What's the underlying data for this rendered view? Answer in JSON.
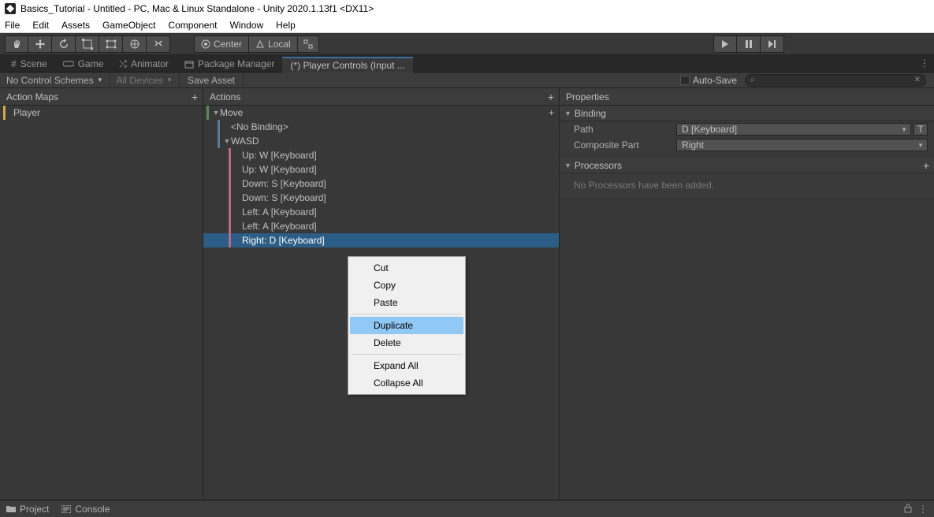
{
  "window": {
    "title": "Basics_Tutorial - Untitled - PC, Mac & Linux Standalone - Unity 2020.1.13f1 <DX11>"
  },
  "menu": {
    "items": [
      "File",
      "Edit",
      "Assets",
      "GameObject",
      "Component",
      "Window",
      "Help"
    ]
  },
  "toolbar": {
    "center": "Center",
    "local": "Local"
  },
  "tabs": {
    "scene": "Scene",
    "game": "Game",
    "animator": "Animator",
    "package_manager": "Package Manager",
    "player_controls": "(*) Player Controls (Input ..."
  },
  "subbar": {
    "control_schemes": "No Control Schemes",
    "devices": "All Devices",
    "save_asset": "Save Asset",
    "auto_save": "Auto-Save"
  },
  "panels": {
    "action_maps": {
      "header": "Action Maps",
      "items": [
        "Player"
      ]
    },
    "actions": {
      "header": "Actions",
      "tree": [
        {
          "label": "Move",
          "type": "action",
          "expanded": true
        },
        {
          "label": "<No Binding>",
          "type": "binding",
          "indent": 1
        },
        {
          "label": "WASD",
          "type": "composite",
          "indent": 1,
          "expanded": true
        },
        {
          "label": "Up: W [Keyboard]",
          "type": "part",
          "indent": 2
        },
        {
          "label": "Up: W [Keyboard]",
          "type": "part",
          "indent": 2
        },
        {
          "label": "Down: S [Keyboard]",
          "type": "part",
          "indent": 2
        },
        {
          "label": "Down: S [Keyboard]",
          "type": "part",
          "indent": 2
        },
        {
          "label": "Left: A [Keyboard]",
          "type": "part",
          "indent": 2
        },
        {
          "label": "Left: A [Keyboard]",
          "type": "part",
          "indent": 2
        },
        {
          "label": "Right: D [Keyboard]",
          "type": "part",
          "indent": 2,
          "selected": true
        }
      ]
    },
    "properties": {
      "header": "Properties",
      "binding_section": "Binding",
      "path_label": "Path",
      "path_value": "D [Keyboard]",
      "composite_label": "Composite Part",
      "composite_value": "Right",
      "processors_section": "Processors",
      "processors_empty": "No Processors have been added.",
      "t_button": "T"
    }
  },
  "context_menu": {
    "cut": "Cut",
    "copy": "Copy",
    "paste": "Paste",
    "duplicate": "Duplicate",
    "delete": "Delete",
    "expand_all": "Expand All",
    "collapse_all": "Collapse All"
  },
  "bottom": {
    "project": "Project",
    "console": "Console"
  }
}
